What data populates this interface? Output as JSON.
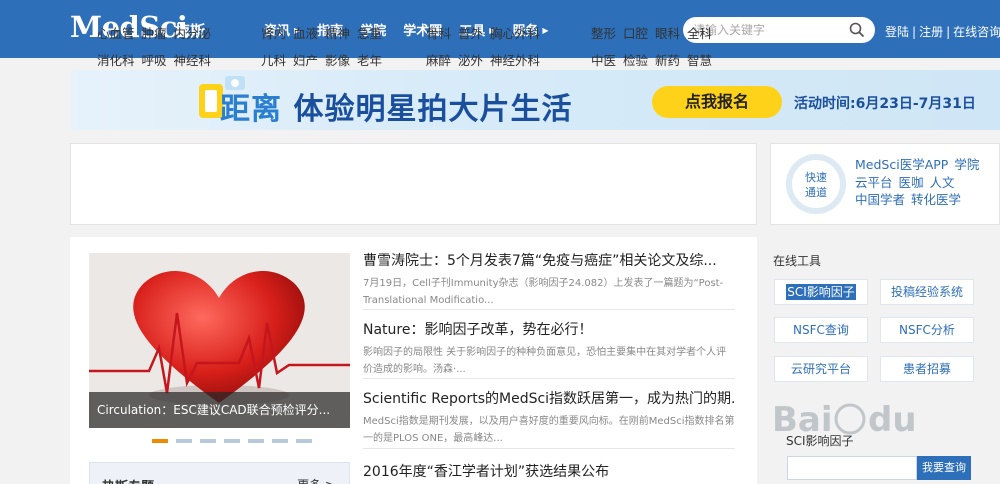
{
  "header": {
    "logo": "MedSci",
    "logo_cn": "梅斯",
    "nav": [
      {
        "label": "资讯",
        "dropdown": true
      },
      {
        "label": "指南",
        "dropdown": false
      },
      {
        "label": "学院",
        "dropdown": false
      },
      {
        "label": "学术圈",
        "dropdown": false
      },
      {
        "label": "工具",
        "dropdown": true
      },
      {
        "label": "服务",
        "dropdown": true
      }
    ],
    "search_placeholder": "请输入关键字",
    "links": [
      "登陆",
      "注册",
      "在线咨询"
    ]
  },
  "banner": {
    "text_part1": "距离",
    "text_part2": "体验明星拍大片生活",
    "button": "点我报名",
    "time": "活动时间:6月23日-7月31日"
  },
  "categories": [
    [
      [
        "心血管",
        "肿瘤",
        "内分泌"
      ],
      [
        "消化科",
        "呼吸",
        "神经科"
      ]
    ],
    [
      [
        "肾内",
        "血液",
        "精神",
        "急重"
      ],
      [
        "儿科",
        "妇产",
        "影像",
        "老年"
      ]
    ],
    [
      [
        "骨科",
        "普外",
        "胸心外科"
      ],
      [
        "麻醉",
        "泌外",
        "神经外科"
      ]
    ],
    [
      [
        "整形",
        "口腔",
        "眼科",
        "全科"
      ],
      [
        "中医",
        "检验",
        "新药",
        "智慧"
      ]
    ]
  ],
  "quick": {
    "circle_line1": "快速",
    "circle_line2": "通道",
    "rows": [
      [
        "MedSci医学APP",
        "学院"
      ],
      [
        "云平台",
        "医咖",
        "人文"
      ],
      [
        "中国学者",
        "转化医学"
      ]
    ]
  },
  "slider": {
    "caption": "Circulation：ESC建议CAD联合预检评分...",
    "dot_count": 7,
    "active_dot": 1
  },
  "topics": {
    "title": "热斯专题",
    "more": "更多 >"
  },
  "news": [
    {
      "title": "曹雪涛院士：5个月发表7篇“免疫与癌症”相关论文及综...",
      "desc": "7月19日，Cell子刊Immunity杂志（影响因子24.082）上发表了一篇题为“Post-Translational Modificatio..."
    },
    {
      "title": "Nature：影响因子改革，势在必行！",
      "desc": "影响因子的局限性 关于影响因子的种种负面意见，恐怕主要集中在其对学者个人评价造成的影响。汤森·..."
    },
    {
      "title": "Scientific Reports的MedSci指数跃居第一，成为热门的期...",
      "desc": "MedSci指数是期刊发展，以及用户喜好度的重要风向标。在刚前MedSci指数排名第一的是PLOS ONE，最高峰达..."
    },
    {
      "title": "2016年度“香江学者计划”获选结果公布",
      "desc": ""
    }
  ],
  "tools": {
    "title": "在线工具",
    "buttons": [
      "SCI影响因子",
      "投稿经验系统",
      "NSFC查询",
      "NSFC分析",
      "云研究平台",
      "患者招募"
    ],
    "sci_label": "SCI影响因子",
    "query_button": "我要查询"
  },
  "colors": {
    "header_blue": "#2e6fb9",
    "accent_orange": "#f08a00",
    "banner_yellow": "#ffd21a"
  }
}
